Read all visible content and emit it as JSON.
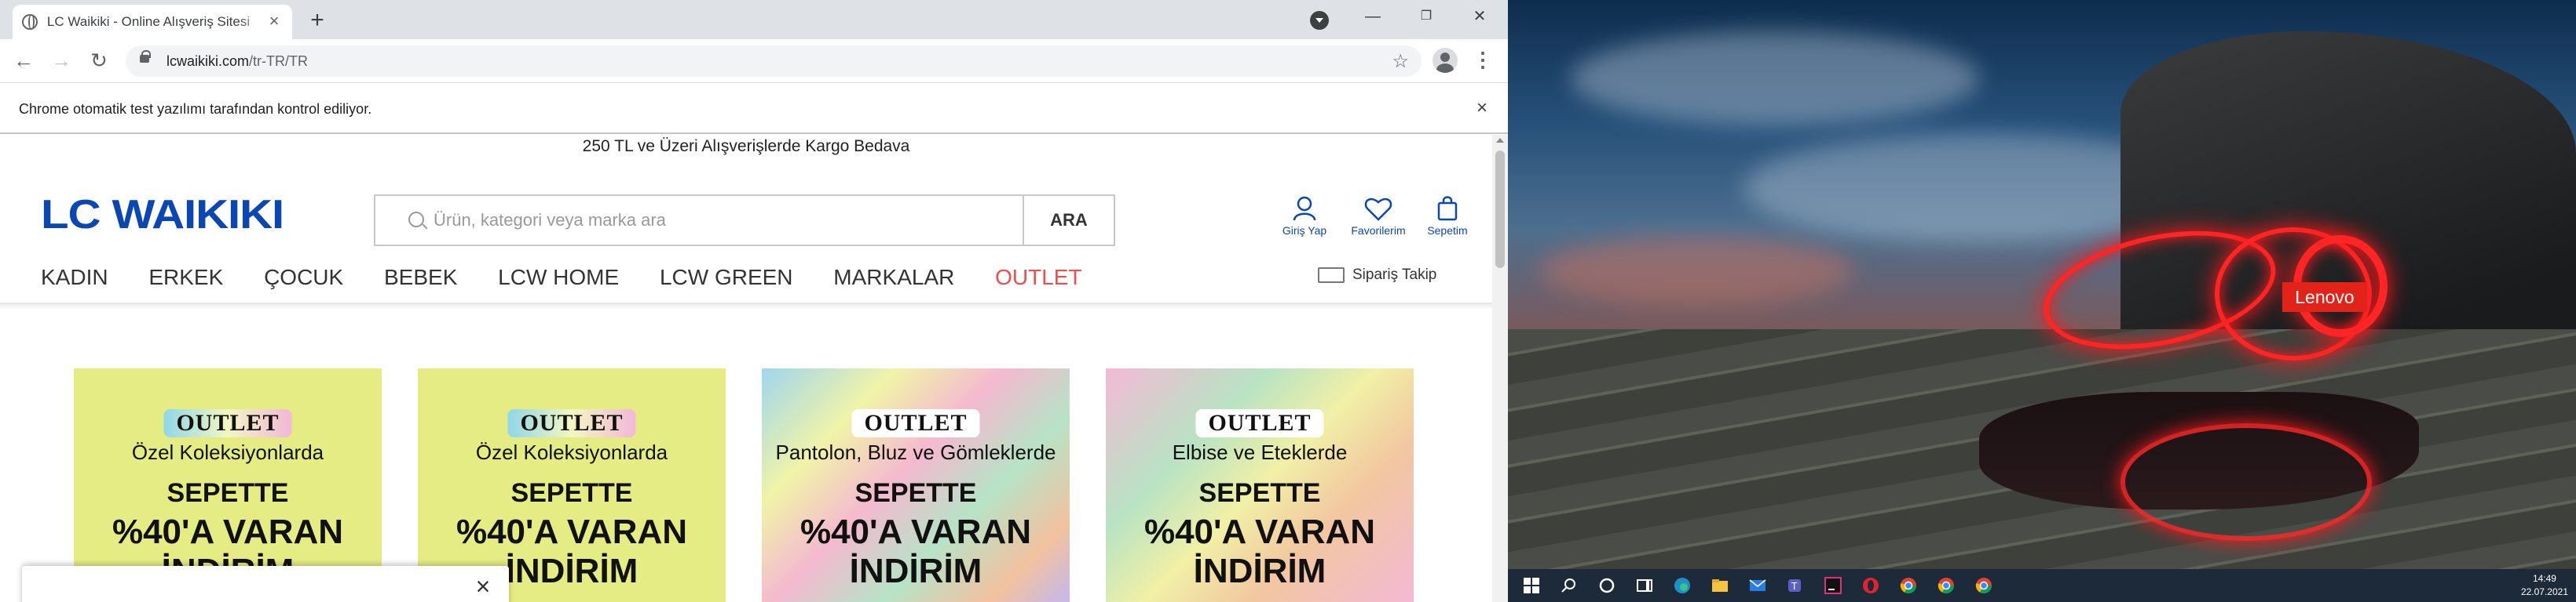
{
  "browser": {
    "tab_title": "LC Waikiki - Online Alışveriş Sitesi",
    "tab_close": "×",
    "new_tab": "+",
    "url_host": "lcwaikiki.com",
    "url_path": "/tr-TR/TR",
    "infobar_text": "Chrome otomatik test yazılımı tarafından kontrol ediliyor.",
    "infobar_close": "×",
    "window_controls": [
      "—",
      "❐",
      "✕"
    ]
  },
  "site": {
    "promo_bar": "250 TL ve Üzeri Alışverişlerde Kargo Bedava",
    "logo": "LC WAIKIKI",
    "search_placeholder": "Ürün, kategori veya marka ara",
    "search_button": "ARA",
    "header_icons": [
      {
        "label": "Giriş Yap",
        "icon": "user-icon"
      },
      {
        "label": "Favorilerim",
        "icon": "heart-icon"
      },
      {
        "label": "Sepetim",
        "icon": "bag-icon"
      }
    ],
    "nav": [
      "KADIN",
      "ERKEK",
      "ÇOCUK",
      "BEBEK",
      "LCW HOME",
      "LCW GREEN",
      "MARKALAR",
      "OUTLET"
    ],
    "order_tracking": "Sipariş Takip",
    "cards": [
      {
        "tag": "OUTLET",
        "subtitle": "Özel Koleksiyonlarda",
        "line1": "SEPETTE",
        "line2": "%40'A VARAN",
        "line3": "İNDİRİM"
      },
      {
        "tag": "OUTLET",
        "subtitle": "Özel Koleksiyonlarda",
        "line1": "SEPETTE",
        "line2": "%40'A VARAN",
        "line3": "İNDİRİM"
      },
      {
        "tag": "OUTLET",
        "subtitle": "Pantolon, Bluz ve Gömleklerde",
        "line1": "SEPETTE",
        "line2": "%40'A VARAN",
        "line3": "İNDİRİM"
      },
      {
        "tag": "OUTLET",
        "subtitle": "Elbise ve Eteklerde",
        "line1": "SEPETTE",
        "line2": "%40'A VARAN",
        "line3": "İNDİRİM"
      }
    ],
    "cookie_close": "×"
  },
  "desktop": {
    "brand_badge": "Lenovo",
    "taskbar_time": "14:49",
    "taskbar_date": "22.07.2021"
  },
  "colors": {
    "brand_blue": "#0a46b4",
    "outlet_red": "#ec4d4d"
  }
}
